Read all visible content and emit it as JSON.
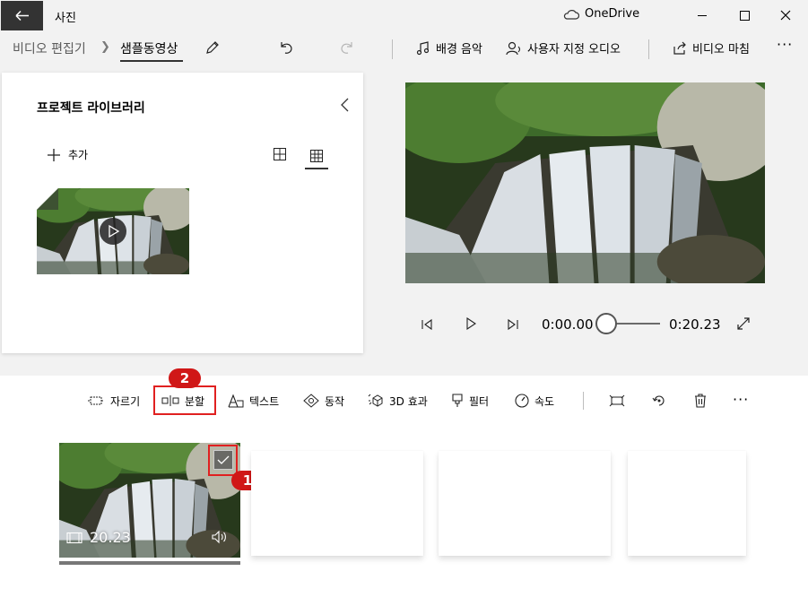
{
  "app": {
    "title": "사진",
    "onedrive_label": "OneDrive"
  },
  "window_controls": [
    "minimize",
    "maximize",
    "close"
  ],
  "breadcrumb": {
    "parent": "비디오 편집기",
    "current": "샘플동영상"
  },
  "toolbar": {
    "background_music": "배경 음악",
    "custom_audio": "사용자 지정 오디오",
    "finish_video": "비디오 마침",
    "more": "···"
  },
  "library": {
    "title": "프로젝트 라이브러리",
    "add": "추가"
  },
  "player": {
    "current_time": "0:00.00",
    "total_time": "0:20.23",
    "progress": 0
  },
  "storyboard_tools": {
    "trim": "자르기",
    "split": "분할",
    "text": "텍스트",
    "motion": "동작",
    "effects3d": "3D 효과",
    "filters": "필터",
    "speed": "속도",
    "more": "···"
  },
  "clip": {
    "duration": "20.23"
  },
  "badges": {
    "one": "1",
    "two": "2"
  },
  "colors": {
    "highlight": "#e02020",
    "badge": "#d01717",
    "title_bar_back": "#333333"
  }
}
